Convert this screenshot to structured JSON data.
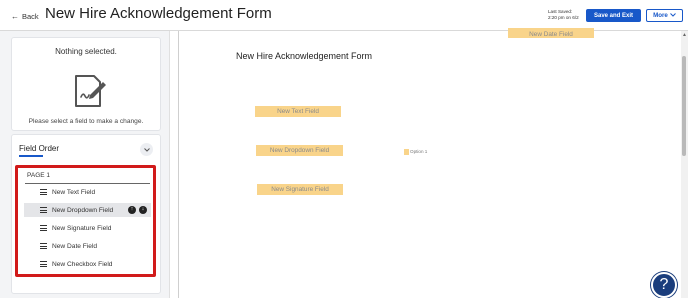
{
  "header": {
    "back_label": "Back",
    "title": "New Hire Acknowledgement Form",
    "last_saved_label": "Last Saved:",
    "last_saved_value": "2:20 pm on 6/2",
    "save_exit_label": "Save and Exit",
    "more_label": "More"
  },
  "sidebar": {
    "nothing_selected": "Nothing selected.",
    "please_select": "Please select a field to make a change.",
    "field_order_title": "Field Order",
    "page_label": "PAGE 1",
    "items": [
      {
        "label": "New Text Field"
      },
      {
        "label": "New Dropdown Field"
      },
      {
        "label": "New Signature Field"
      },
      {
        "label": "New Date Field"
      },
      {
        "label": "New Checkbox Field"
      }
    ]
  },
  "canvas": {
    "document_title": "New Hire Acknowledgement Form",
    "fields": {
      "date": "New Date Field",
      "text": "New Text Field",
      "dropdown": "New Dropdown Field",
      "signature": "New Signature Field"
    },
    "option_label": "Option 1"
  },
  "colors": {
    "primary": "#1858c9",
    "field_fill": "#f9d48a",
    "highlight_border": "#d11a1a",
    "help_button": "#1a3d7c"
  }
}
